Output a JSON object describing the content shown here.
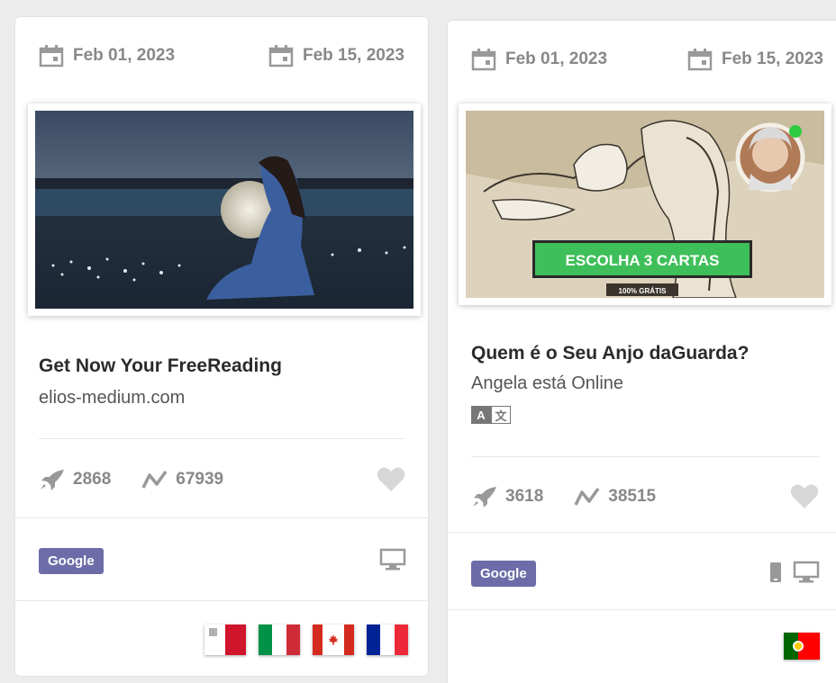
{
  "cards": [
    {
      "start_date": "Feb 01, 2023",
      "end_date": "Feb 15, 2023",
      "title": "Get Now Your FreeReading",
      "subtitle": "elios-medium.com",
      "stats": {
        "launches": "2868",
        "impressions": "67939"
      },
      "network": "Google",
      "devices": [
        "desktop-icon"
      ],
      "flags": [
        "malta-flag",
        "italy-flag",
        "canada-flag",
        "france-flag"
      ]
    },
    {
      "start_date": "Feb 01, 2023",
      "end_date": "Feb 15, 2023",
      "title": "Quem é o Seu Anjo daGuarda?",
      "subtitle": "Angela está Online",
      "translate_badge": {
        "a": "A",
        "b": "文"
      },
      "banner_text": "ESCOLHA 3 CARTAS",
      "banner_small": "100% GRÁTIS",
      "stats": {
        "launches": "3618",
        "impressions": "38515"
      },
      "network": "Google",
      "devices": [
        "mobile-icon",
        "desktop-icon"
      ],
      "flags": [
        "portugal-flag"
      ]
    }
  ],
  "colors": {
    "badge": "#6d6ca8",
    "muted": "#888888",
    "banner_green": "#3fbf5a"
  }
}
